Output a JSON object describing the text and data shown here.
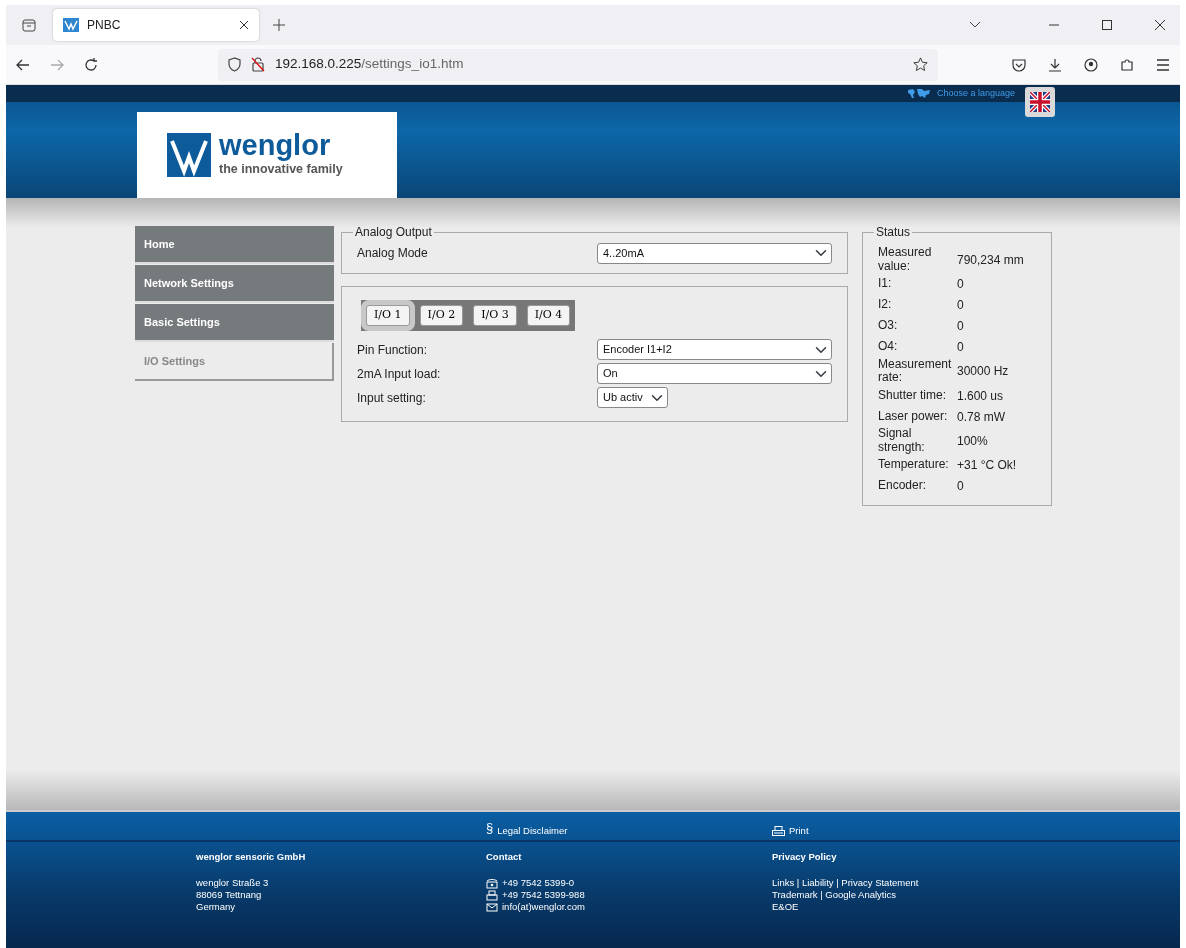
{
  "browser": {
    "tab_title": "PNBC",
    "url_host": "192.168.0.225",
    "url_path": "/settings_io1.htm"
  },
  "header": {
    "language_label": "Choose a language"
  },
  "logo": {
    "brand": "wenglor",
    "tagline": "the innovative family"
  },
  "sidebar": {
    "items": [
      {
        "label": "Home",
        "selected": false
      },
      {
        "label": "Network Settings",
        "selected": false
      },
      {
        "label": "Basic Settings",
        "selected": false
      },
      {
        "label": "I/O Settings",
        "selected": true
      }
    ]
  },
  "analog_output": {
    "legend": "Analog Output",
    "label": "Analog Mode",
    "value": "4..20mA"
  },
  "io": {
    "tabs": [
      {
        "label": "I/O 1",
        "selected": true
      },
      {
        "label": "I/O 2",
        "selected": false
      },
      {
        "label": "I/O 3",
        "selected": false
      },
      {
        "label": "I/O 4",
        "selected": false
      }
    ],
    "fields": [
      {
        "label": "Pin Function:",
        "value": "Encoder I1+I2",
        "kind": "wide"
      },
      {
        "label": "2mA Input load:",
        "value": "On",
        "kind": "wide"
      },
      {
        "label": "Input setting:",
        "value": "Ub activ",
        "kind": "narrow"
      }
    ]
  },
  "status": {
    "legend": "Status",
    "rows": [
      {
        "label": "Measured value:",
        "value": "790,234 mm"
      },
      {
        "label": "I1:",
        "value": "0"
      },
      {
        "label": "I2:",
        "value": "0"
      },
      {
        "label": "O3:",
        "value": "0"
      },
      {
        "label": "O4:",
        "value": "0"
      },
      {
        "label": "Measurement rate:",
        "value": "30000 Hz"
      },
      {
        "label": "Shutter time:",
        "value": "1.600 us"
      },
      {
        "label": "Laser power:",
        "value": "0.78 mW"
      },
      {
        "label": "Signal strength:",
        "value": "100%"
      },
      {
        "label": "Temperature:",
        "value": "+31 °C Ok!"
      },
      {
        "label": "Encoder:",
        "value": "0"
      }
    ]
  },
  "footer": {
    "legal_sign": "§",
    "legal": "Legal Disclaimer",
    "print": "Print",
    "columns": [
      {
        "heading": "wenglor sensoric GmbH",
        "lines": [
          {
            "text": "wenglor Straße 3",
            "kind": "plain"
          },
          {
            "text": "88069 Tettnang",
            "kind": "plain"
          },
          {
            "text": "Germany",
            "kind": "plain"
          }
        ]
      },
      {
        "heading": "Contact",
        "lines": [
          {
            "text": "+49 7542 5399-0",
            "kind": "phone"
          },
          {
            "text": "+49 7542 5399-988",
            "kind": "fax"
          },
          {
            "text": "info(at)wenglor.com",
            "kind": "mail"
          }
        ]
      },
      {
        "heading": "Privacy Policy",
        "lines": [
          {
            "text": "Links | Liability | Privacy Statement",
            "kind": "plain"
          },
          {
            "text": "Trademark | Google Analytics",
            "kind": "plain"
          },
          {
            "text": "E&OE",
            "kind": "plain"
          }
        ]
      }
    ]
  }
}
